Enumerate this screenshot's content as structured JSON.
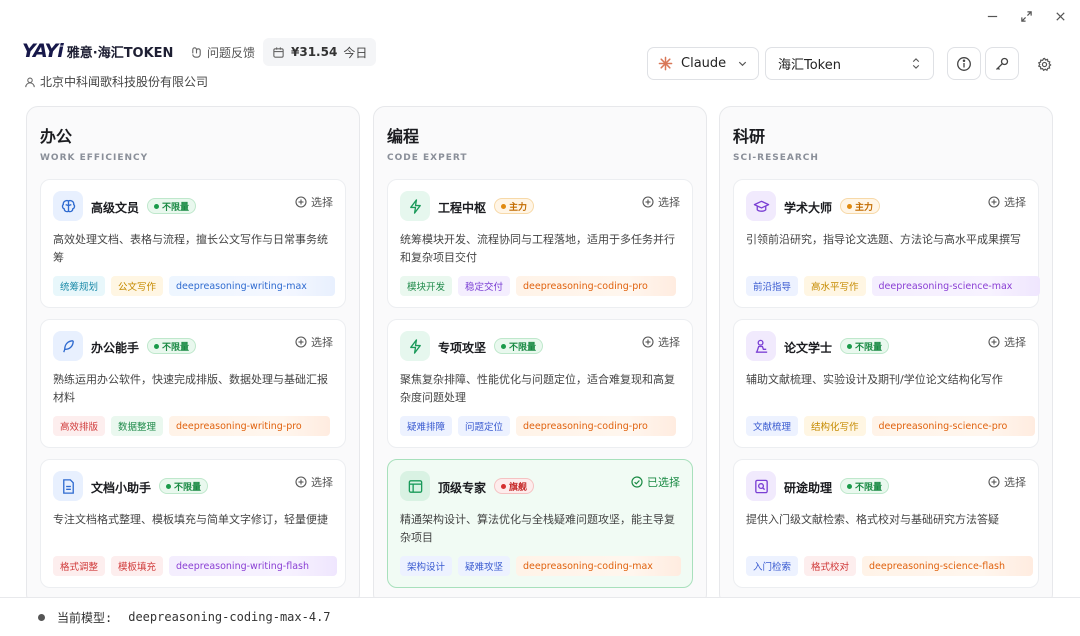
{
  "header": {
    "logo_text": "YAYi",
    "brand_name": "雅意·海汇TOKEN",
    "feedback_label": "问题反馈",
    "cost_amount": "¥31.54",
    "cost_period": "今日",
    "company": "北京中科闻歌科技股份有限公司",
    "model_select": "Claude",
    "provider_select": "海汇Token"
  },
  "columns": [
    {
      "title": "办公",
      "subtitle": "WORK EFFICIENCY",
      "cards": [
        {
          "name": "高级文员",
          "badge": "不限量",
          "choose": "选择",
          "desc": "高效处理文档、表格与流程，擅长公文写作与日常事务统筹",
          "tags": [
            "统筹规划",
            "公文写作"
          ],
          "model": "deepreasoning-writing-max"
        },
        {
          "name": "办公能手",
          "badge": "不限量",
          "choose": "选择",
          "desc": "熟练运用办公软件，快速完成排版、数据处理与基础汇报材料",
          "tags": [
            "高效排版",
            "数据整理"
          ],
          "model": "deepreasoning-writing-pro"
        },
        {
          "name": "文档小助手",
          "badge": "不限量",
          "choose": "选择",
          "desc": "专注文档格式整理、模板填充与简单文字修订，轻量便捷",
          "tags": [
            "格式调整",
            "模板填充"
          ],
          "model": "deepreasoning-writing-flash"
        }
      ]
    },
    {
      "title": "编程",
      "subtitle": "CODE EXPERT",
      "cards": [
        {
          "name": "工程中枢",
          "badge": "主力",
          "choose": "选择",
          "desc": "统筹模块开发、流程协同与工程落地，适用于多任务并行和复杂项目交付",
          "tags": [
            "模块开发",
            "稳定交付"
          ],
          "model": "deepreasoning-coding-pro"
        },
        {
          "name": "专项攻坚",
          "badge": "不限量",
          "choose": "选择",
          "desc": "聚焦复杂排障、性能优化与问题定位，适合难复现和高复杂度问题处理",
          "tags": [
            "疑难排障",
            "问题定位"
          ],
          "model": "deepreasoning-coding-pro"
        },
        {
          "name": "顶级专家",
          "badge": "旗舰",
          "choose": "已选择",
          "desc": "精通架构设计、算法优化与全栈疑难问题攻坚，能主导复杂项目",
          "tags": [
            "架构设计",
            "疑难攻坚"
          ],
          "model": "deepreasoning-coding-max"
        }
      ]
    },
    {
      "title": "科研",
      "subtitle": "SCI-RESEARCH",
      "cards": [
        {
          "name": "学术大师",
          "badge": "主力",
          "choose": "选择",
          "desc": "引领前沿研究，指导论文选题、方法论与高水平成果撰写",
          "tags": [
            "前沿指导",
            "高水平写作"
          ],
          "model": "deepreasoning-science-max"
        },
        {
          "name": "论文学士",
          "badge": "不限量",
          "choose": "选择",
          "desc": "辅助文献梳理、实验设计及期刊/学位论文结构化写作",
          "tags": [
            "文献梳理",
            "结构化写作"
          ],
          "model": "deepreasoning-science-pro"
        },
        {
          "name": "研途助理",
          "badge": "不限量",
          "choose": "选择",
          "desc": "提供入门级文献检索、格式校对与基础研究方法答疑",
          "tags": [
            "入门检索",
            "格式校对"
          ],
          "model": "deepreasoning-science-flash"
        }
      ]
    }
  ],
  "footer": {
    "label": "当前模型:",
    "value": "deepreasoning-coding-max-4.7"
  },
  "colors": {
    "accent_green": "#1a8a44",
    "selected_card_bg": "#f1fbf4",
    "logo_navy": "#17184a"
  }
}
